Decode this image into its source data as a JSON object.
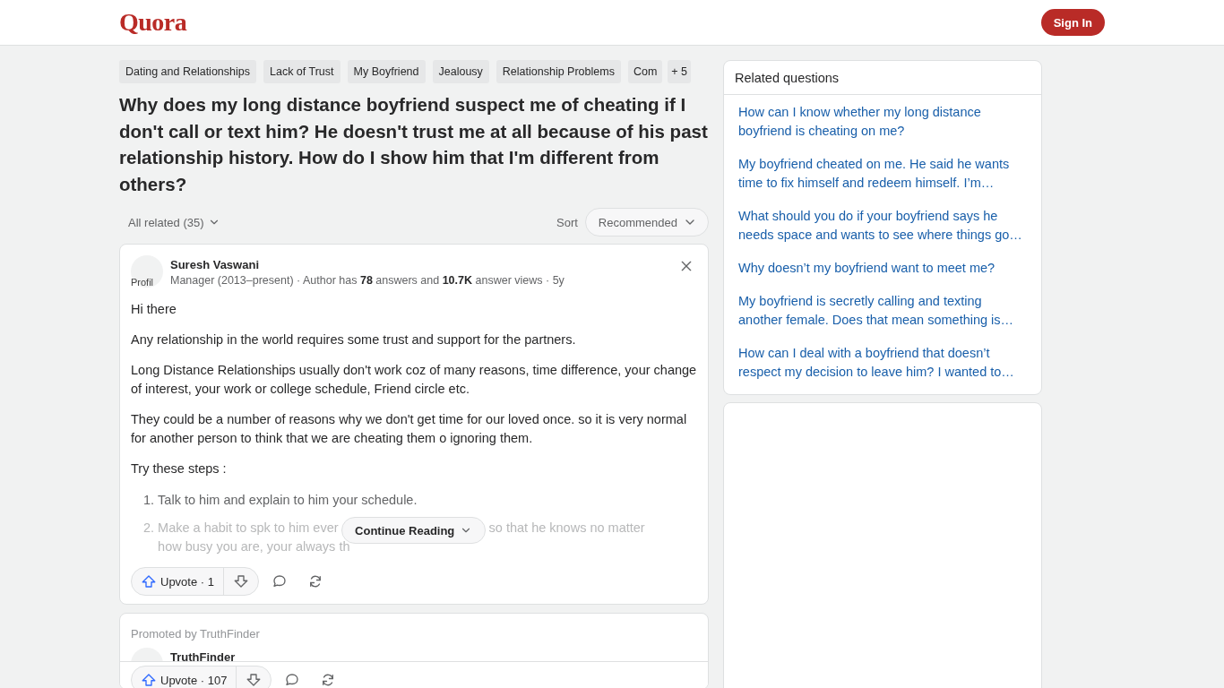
{
  "header": {
    "logo": "Quora",
    "sign_in": "Sign In"
  },
  "topics": [
    "Dating and Relationships",
    "Lack of Trust",
    "My Boyfriend",
    "Jealousy",
    "Relationship Problems",
    "Com"
  ],
  "topics_more": "+ 5",
  "question": "Why does my long distance boyfriend suspect me of cheating if I don't call or text him? He doesn't trust me at all because of his past relationship history. How do I show him that I'm different from others?",
  "filter": "All related (35)",
  "sort_label": "Sort",
  "sort_value": "Recommended",
  "answer": {
    "avatar_alt": "Profil",
    "author": "Suresh Vaswani",
    "credential": "Manager (2013–present) · Author has **78** answers and **10.7K** answer views · 5y",
    "paragraphs": [
      "Hi there",
      "Any relationship in the world requires some trust and support for the partners.",
      "Long Distance Relationships usually don't work coz of many reasons, time difference, your change of interest, your work or college schedule, Friend circle etc.",
      "They could be a number of reasons why we don't get time for our loved once. so it is very normal for another person to think that we are cheating them o ignoring them.",
      "Try these steps :"
    ],
    "steps": [
      {
        "number": "1.",
        "lines": [
          [
            "Talk to him and explain to him your schedule."
          ]
        ],
        "faded": false
      },
      {
        "number": "2.",
        "lines": [
          [
            "Make a habit to spk to him ever",
            "so that he knows no matter"
          ],
          [
            "how busy you are, your always th"
          ]
        ],
        "faded": true
      }
    ],
    "continue": "Continue Reading",
    "upvote": "Upvote · 1"
  },
  "promoted": {
    "label": "Promoted by TruthFinder",
    "author": "TruthFinder",
    "upvote": "Upvote · 107"
  },
  "related": {
    "title": "Related questions",
    "items": [
      "How can I know whether my long distance boyfriend is cheating on me?",
      "My boyfriend cheated on me. He said he wants time to fix himself and redeem himself. I’m…",
      "What should you do if your boyfriend says he needs space and wants to see where things go…",
      "Why doesn’t my boyfriend want to meet me?",
      "My boyfriend is secretly calling and texting another female. Does that mean something is…",
      "How can I deal with a boyfriend that doesn’t respect my decision to leave him? I wanted to…"
    ]
  }
}
